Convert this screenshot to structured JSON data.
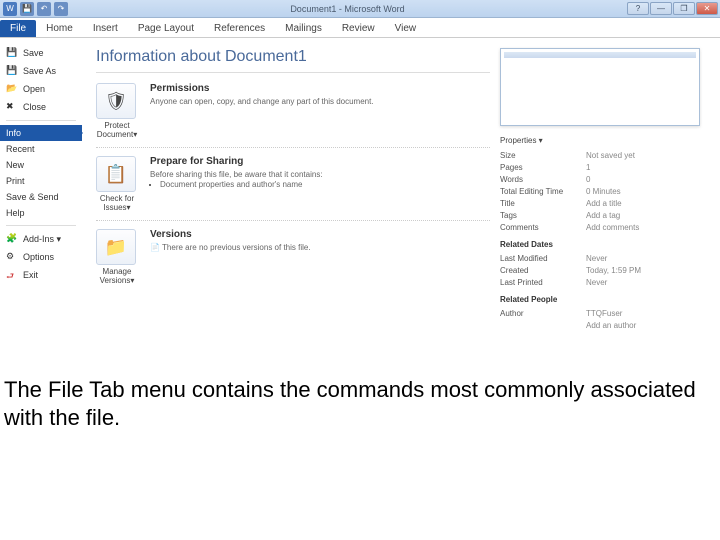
{
  "titlebar": {
    "title": "Document1 - Microsoft Word"
  },
  "qat": {
    "icons": [
      "W",
      "💾",
      "↶",
      "↷"
    ]
  },
  "wincontrols": {
    "min": "—",
    "max": "❐",
    "close": "✕",
    "help": "?"
  },
  "ribbon": {
    "tabs": [
      "File",
      "Home",
      "Insert",
      "Page Layout",
      "References",
      "Mailings",
      "Review",
      "View"
    ]
  },
  "sidebar": {
    "group1": [
      {
        "icon": "💾",
        "label": "Save"
      },
      {
        "icon": "💾",
        "label": "Save As"
      },
      {
        "icon": "📂",
        "label": "Open"
      },
      {
        "icon": "✖",
        "label": "Close"
      }
    ],
    "group2": [
      {
        "label": "Info",
        "selected": true
      },
      {
        "label": "Recent"
      },
      {
        "label": "New"
      },
      {
        "label": "Print"
      },
      {
        "label": "Save & Send"
      },
      {
        "label": "Help"
      }
    ],
    "group3": [
      {
        "icon": "🧩",
        "label": "Add-Ins ▾"
      },
      {
        "icon": "⚙",
        "label": "Options"
      },
      {
        "icon": "⮐",
        "label": "Exit"
      }
    ]
  },
  "page": {
    "title": "Information about Document1"
  },
  "sections": {
    "perm": {
      "btn": "Protect Document▾",
      "h": "Permissions",
      "p": "Anyone can open, copy, and change any part of this document."
    },
    "share": {
      "btn": "Check for Issues▾",
      "h": "Prepare for Sharing",
      "p": "Before sharing this file, be aware that it contains:",
      "li": "Document properties and author's name"
    },
    "ver": {
      "btn": "Manage Versions▾",
      "h": "Versions",
      "li": "There are no previous versions of this file."
    }
  },
  "props": {
    "header": "Properties ▾",
    "rows": [
      {
        "k": "Size",
        "v": "Not saved yet"
      },
      {
        "k": "Pages",
        "v": "1"
      },
      {
        "k": "Words",
        "v": "0"
      },
      {
        "k": "Total Editing Time",
        "v": "0 Minutes"
      },
      {
        "k": "Title",
        "v": "Add a title"
      },
      {
        "k": "Tags",
        "v": "Add a tag"
      },
      {
        "k": "Comments",
        "v": "Add comments"
      }
    ],
    "dates_h": "Related Dates",
    "dates": [
      {
        "k": "Last Modified",
        "v": "Never"
      },
      {
        "k": "Created",
        "v": "Today, 1:59 PM"
      },
      {
        "k": "Last Printed",
        "v": "Never"
      }
    ],
    "people_h": "Related People",
    "people": [
      {
        "k": "Author",
        "v": "TTQFuser"
      },
      {
        "k": "",
        "v": "Add an author"
      }
    ]
  },
  "caption": "The File Tab menu contains the commands most commonly associated with the file."
}
